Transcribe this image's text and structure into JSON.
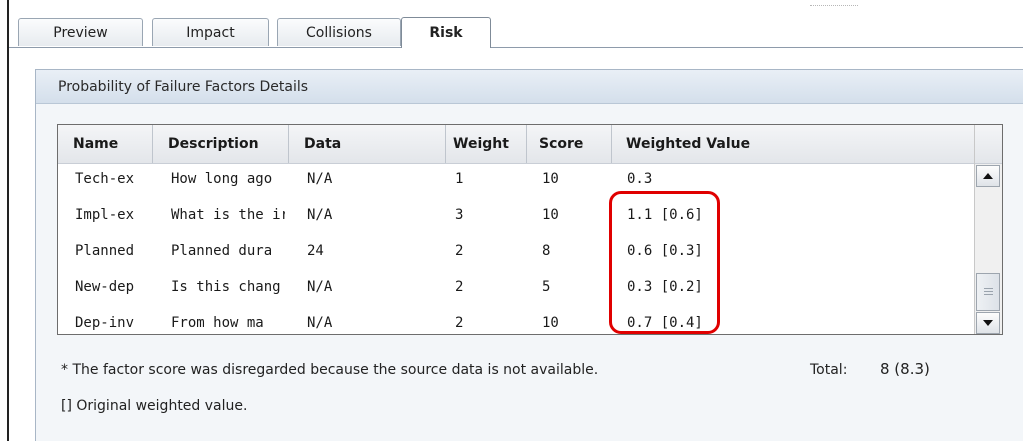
{
  "tabs": [
    {
      "label": "Preview",
      "active": false
    },
    {
      "label": "Impact",
      "active": false
    },
    {
      "label": "Collisions",
      "active": false
    },
    {
      "label": "Risk",
      "active": true
    }
  ],
  "panel": {
    "title": "Probability of Failure Factors Details"
  },
  "table": {
    "columns": [
      "Name",
      "Description",
      "Data",
      "Weight",
      "Score",
      "Weighted Value"
    ],
    "rows": [
      {
        "name": "Tech-ex",
        "description": "How long ago",
        "data": "N/A",
        "weight": "1",
        "score": "10",
        "weighted_value": "0.3"
      },
      {
        "name": "Impl-ex",
        "description": "What is the ir",
        "data": "N/A",
        "weight": "3",
        "score": "10",
        "weighted_value": "1.1 [0.6]"
      },
      {
        "name": "Planned",
        "description": "Planned dura",
        "data": "24",
        "weight": "2",
        "score": "8",
        "weighted_value": "0.6 [0.3]"
      },
      {
        "name": "New-dep",
        "description": "Is this chang",
        "data": "N/A",
        "weight": "2",
        "score": "5",
        "weighted_value": "0.3 [0.2]"
      },
      {
        "name": "Dep-inv",
        "description": "From how ma",
        "data": "N/A",
        "weight": "2",
        "score": "10",
        "weighted_value": "0.7 [0.4]"
      }
    ]
  },
  "footer": {
    "note": "* The factor score was disregarded because the source data is not available.",
    "legend": "[] Original weighted value.",
    "total_label": "Total:",
    "total_value": "8 (8.3)"
  },
  "colors": {
    "highlight": "#e00000",
    "panel_header": "#d4dfeb"
  },
  "icons": {
    "scroll_up": "triangle-up-icon",
    "scroll_down": "triangle-down-icon",
    "thumb_grip": "grip-icon"
  }
}
